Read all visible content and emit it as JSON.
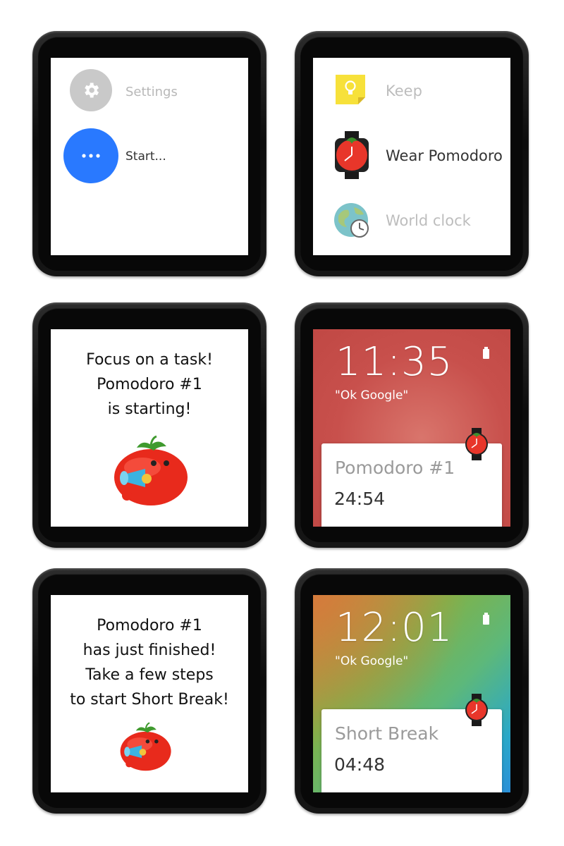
{
  "screen1": {
    "items": [
      {
        "label": "Settings",
        "icon": "gear-icon",
        "color": "#c9c9c9"
      },
      {
        "label": "Start...",
        "icon": "more-icon",
        "color": "#2979ff"
      }
    ]
  },
  "screen2": {
    "items": [
      {
        "label": "Keep",
        "icon": "keep-icon"
      },
      {
        "label": "Wear Pomodoro",
        "icon": "pomodoro-watch-icon"
      },
      {
        "label": "World clock",
        "icon": "world-clock-icon"
      }
    ]
  },
  "screen3": {
    "lines": [
      "Focus on a task!",
      "Pomodoro #1",
      "is starting!"
    ],
    "illustration": "tomato-megaphone-icon"
  },
  "screen4": {
    "time": "11:35",
    "hint": "\"Ok Google\"",
    "card": {
      "title": "Pomodoro #1",
      "timer": "24:54"
    },
    "background": "#c8504c"
  },
  "screen5": {
    "lines": [
      "Pomodoro #1",
      "has just finished!",
      "Take a few steps",
      "to start Short Break!"
    ],
    "illustration": "tomato-megaphone-icon"
  },
  "screen6": {
    "time": "12:01",
    "hint": "\"Ok Google\"",
    "card": {
      "title": "Short Break",
      "timer": "04:48"
    }
  }
}
